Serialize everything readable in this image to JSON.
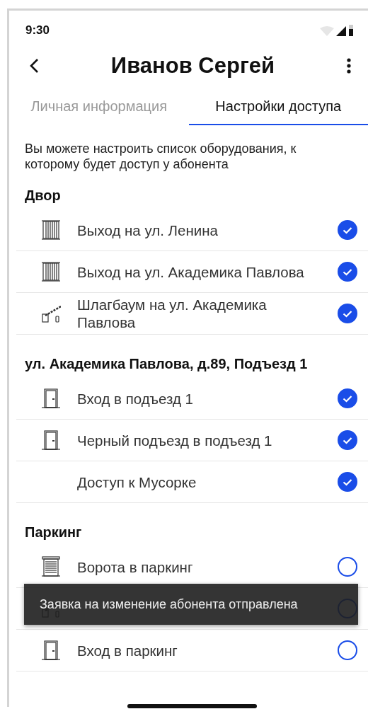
{
  "status_bar": {
    "time": "9:30"
  },
  "header": {
    "title": "Иванов Сергей"
  },
  "tabs": [
    {
      "label": "Личная информация",
      "selected": false
    },
    {
      "label": "Настройки доступа",
      "selected": true
    }
  ],
  "description": "Вы можете настроить список оборудования, к которому будет доступ у абонента",
  "sections": [
    {
      "title": "Двор",
      "items": [
        {
          "kind": "gate",
          "label": "Выход на ул. Ленина",
          "checked": true
        },
        {
          "kind": "gate",
          "label": "Выход на ул. Академика Павлова",
          "checked": true
        },
        {
          "kind": "barrier",
          "label": "Шлагбаум на ул. Академика Павлова",
          "checked": true
        }
      ]
    },
    {
      "title": "ул. Академика Павлова, д.89, Подъезд 1",
      "items": [
        {
          "kind": "door",
          "label": "Вход в подъезд 1",
          "checked": true
        },
        {
          "kind": "door",
          "label": "Черный подъезд в подъезд 1",
          "checked": true
        },
        {
          "kind": "none",
          "label": "Доступ к Мусорке",
          "checked": true
        }
      ]
    },
    {
      "title": "Паркинг",
      "items": [
        {
          "kind": "garage",
          "label": "Ворота в паркинг",
          "checked": false
        },
        {
          "kind": "barrier",
          "checked": false
        },
        {
          "kind": "door",
          "label": "Вход в паркинг",
          "checked": false
        }
      ]
    }
  ],
  "toast": {
    "text": "Заявка на изменение абонента отправлена"
  }
}
